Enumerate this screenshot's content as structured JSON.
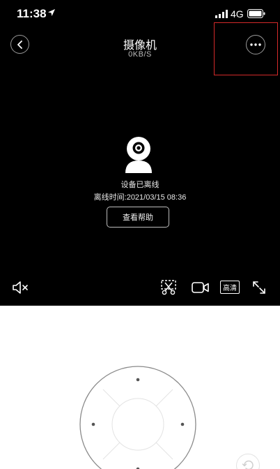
{
  "status_bar": {
    "time": "11:38",
    "network": "4G"
  },
  "header": {
    "title": "摄像机",
    "speed": "0KB/S"
  },
  "offline": {
    "status": "设备已离线",
    "offline_time": "离线时间:2021/03/15 08:36",
    "help_label": "查看帮助"
  },
  "toolbar": {
    "quality_label": "高清"
  },
  "icons": [
    "location-arrow-icon",
    "signal-icon",
    "battery-icon",
    "back-chevron-icon",
    "more-dots-icon",
    "camera-icon",
    "mute-icon",
    "scissors-icon",
    "video-record-icon",
    "fullscreen-icon",
    "rotate-icon"
  ],
  "colors": {
    "highlight": "#d42a2a",
    "video_bg": "#000000"
  }
}
